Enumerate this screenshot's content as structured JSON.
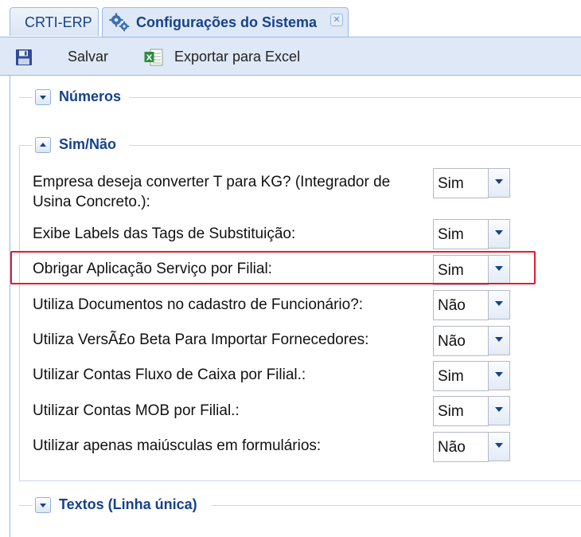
{
  "tabs": {
    "inactive_label": "CRTI-ERP",
    "active_label": "Configurações do Sistema"
  },
  "toolbar": {
    "save_label": "Salvar",
    "export_label": "Exportar para Excel"
  },
  "sections": {
    "numeros": {
      "title": "Números"
    },
    "sim_nao": {
      "title": "Sim/Não"
    },
    "textos": {
      "title": "Textos (Linha única)"
    }
  },
  "rows": [
    {
      "label_line1": "Empresa deseja converter T para KG? (Integrador de",
      "label_line2": "Usina Concreto.):",
      "value": "Sim"
    },
    {
      "label": "Exibe Labels das Tags de Substituição:",
      "value": "Sim"
    },
    {
      "label": "Obrigar Aplicação Serviço por Filial:",
      "value": "Sim"
    },
    {
      "label": "Utiliza Documentos no cadastro de Funcionário?:",
      "value": "Não"
    },
    {
      "label": "Utiliza VersÃ£o Beta Para Importar Fornecedores:",
      "value": "Não"
    },
    {
      "label": "Utilizar Contas Fluxo de Caixa por Filial.:",
      "value": "Sim"
    },
    {
      "label": "Utilizar Contas MOB por Filial.:",
      "value": "Sim"
    },
    {
      "label": "Utilizar apenas maiúsculas em formulários:",
      "value": "Não"
    }
  ],
  "colors": {
    "accent": "#15428b",
    "highlight": "#e8192c"
  }
}
